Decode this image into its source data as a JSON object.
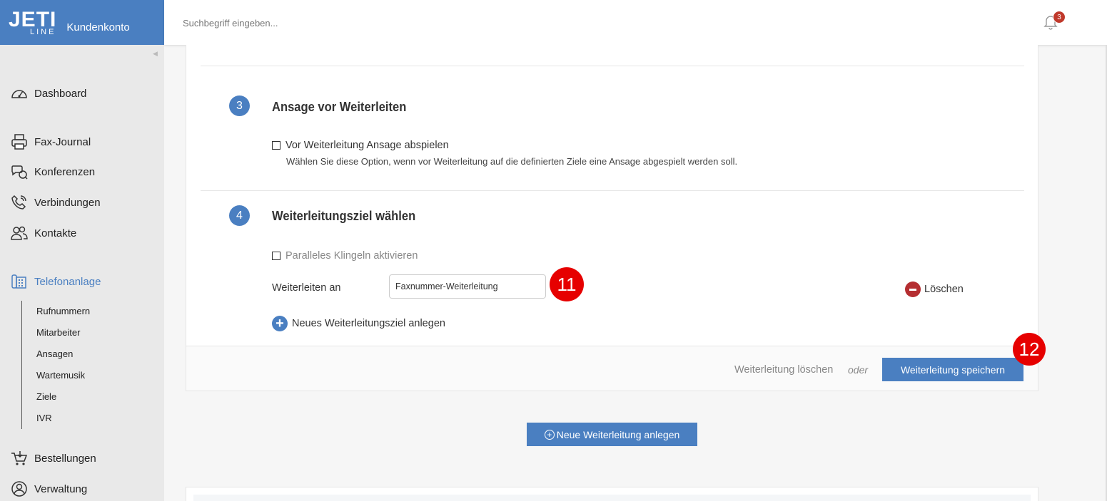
{
  "app": {
    "logo_text": "JETI",
    "logo_sub": "LINE",
    "account_label": "Kundenkonto"
  },
  "header": {
    "search_placeholder": "Suchbegriff eingeben...",
    "notification_count": "3"
  },
  "sidebar": {
    "items": [
      {
        "label": "Dashboard",
        "icon": "speedometer-icon"
      },
      {
        "label": "Fax-Journal",
        "icon": "fax-icon"
      },
      {
        "label": "Konferenzen",
        "icon": "conference-icon"
      },
      {
        "label": "Verbindungen",
        "icon": "phone-icon"
      },
      {
        "label": "Kontakte",
        "icon": "contacts-icon"
      },
      {
        "label": "Telefonanlage",
        "icon": "pbx-icon",
        "active": true
      },
      {
        "label": "Bestellungen",
        "icon": "cart-icon"
      },
      {
        "label": "Verwaltung",
        "icon": "admin-icon"
      }
    ],
    "subitems": [
      "Rufnummern",
      "Mitarbeiter",
      "Ansagen",
      "Wartemusik",
      "Ziele",
      "IVR"
    ]
  },
  "section3": {
    "number": "3",
    "title": "Ansage vor Weiterleiten",
    "checkbox_label": "Vor Weiterleitung Ansage abspielen",
    "hint": "Wählen Sie diese Option, wenn vor Weiterleitung auf die definierten Ziele eine Ansage abgespielt werden soll."
  },
  "section4": {
    "number": "4",
    "title": "Weiterleitungsziel wählen",
    "checkbox_label": "Paralleles Klingeln aktivieren",
    "field_label": "Weiterleiten an",
    "field_value": "Faxnummer-Weiterleitung",
    "delete_label": "Löschen",
    "add_target_label": "Neues Weiterleitungsziel anlegen"
  },
  "footer": {
    "delete_link": "Weiterleitung löschen",
    "or_label": "oder",
    "save_button": "Weiterleitung speichern"
  },
  "new_forward_button": "Neue Weiterleitung anlegen",
  "markers": {
    "m11": "11",
    "m12": "12"
  },
  "colors": {
    "accent": "#4a7fc1",
    "marker": "#e60000",
    "delete": "#b52e31"
  }
}
